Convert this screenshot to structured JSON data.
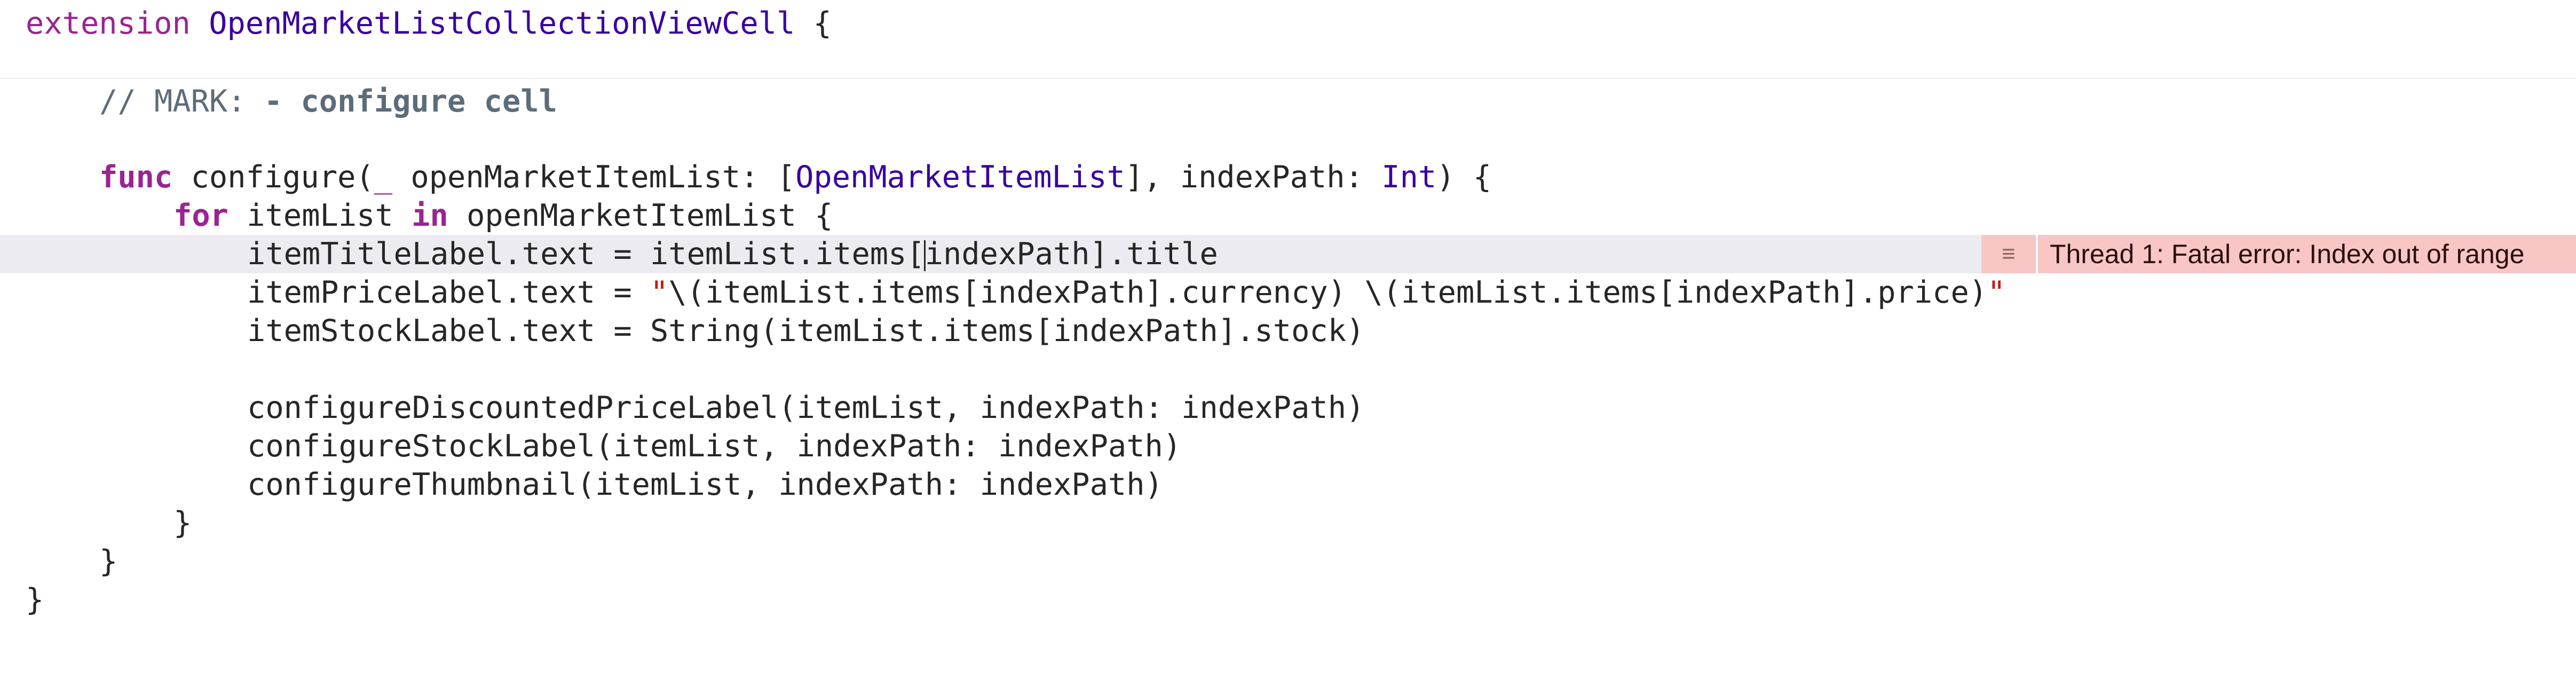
{
  "code_lines": {
    "l1": {
      "kw": "extension",
      "type": "OpenMarketListCollectionViewCell",
      "rest": " {"
    },
    "l2": {
      "comment": "// MARK: ",
      "bold": "- configure cell"
    },
    "l3": {
      "kw": "func",
      "a": " configure(",
      "b": "_",
      "c": " openMarketItemList: [",
      "type1": "OpenMarketItemList",
      "d": "], indexPath: ",
      "type2": "Int",
      "e": ") {"
    },
    "l4": {
      "kw1": "for",
      "a": " itemList ",
      "kw2": "in",
      "b": " openMarketItemList {"
    },
    "l5": {
      "a": "itemTitleLabel.text = itemList.items[",
      "b": "indexPath].title"
    },
    "l6": {
      "a": "itemPriceLabel.text = ",
      "str1": "\"",
      "b": "\\(itemList.items[indexPath].currency) \\(itemList.items[indexPath].price)",
      "str2": "\""
    },
    "l7": "itemStockLabel.text = String(itemList.items[indexPath].stock)",
    "l8": "configureDiscountedPriceLabel(itemList, indexPath: indexPath)",
    "l9": "configureStockLabel(itemList, indexPath: indexPath)",
    "l10": "configureThumbnail(itemList, indexPath: indexPath)",
    "l11": "}",
    "l12": "}",
    "l13": "}"
  },
  "error": {
    "icon": "lines-icon",
    "icon_glyph": "≡",
    "message": "Thread 1: Fatal error: Index out of range"
  },
  "colors": {
    "keyword": "#9b2393",
    "type": "#3900a0",
    "comment": "#5d6c79",
    "string": "#c41a16",
    "current_line": "#ecebf1",
    "error_banner": "#f8c6c5"
  }
}
